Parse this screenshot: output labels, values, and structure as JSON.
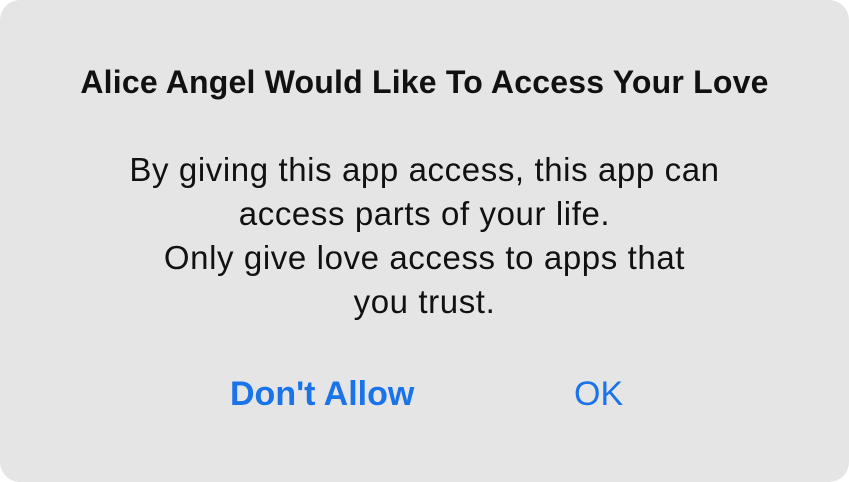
{
  "dialog": {
    "title": "Alice Angel Would Like To Access Your Love",
    "message_lines": [
      "By giving this app access, this app can",
      "access parts of your life.",
      "Only give love access to apps that",
      "you trust."
    ],
    "buttons": {
      "deny_label": "Don't Allow",
      "ok_label": "OK"
    }
  },
  "colors": {
    "background": "#e5e5e5",
    "accent": "#1a73e8",
    "text": "#111111"
  }
}
